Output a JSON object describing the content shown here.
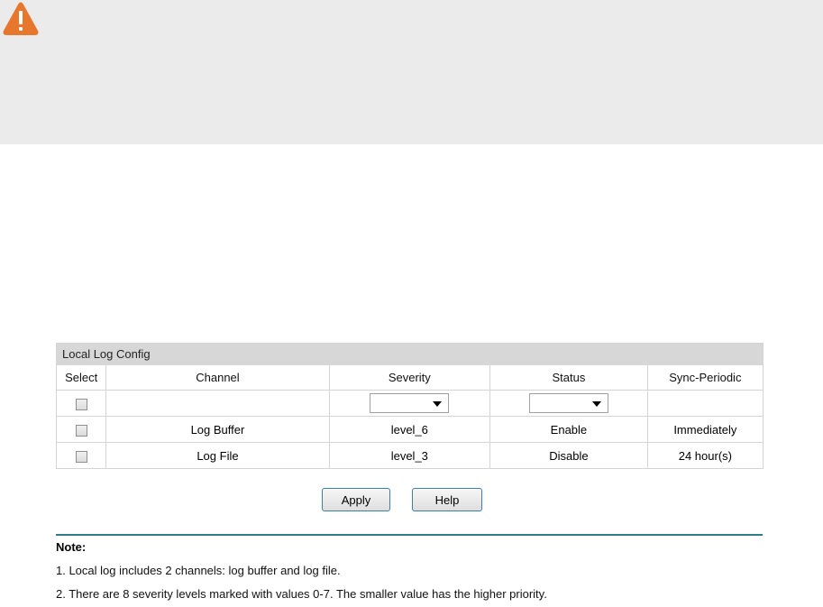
{
  "panel": {
    "title": "Local Log Config",
    "headers": [
      "Select",
      "Channel",
      "Severity",
      "Status",
      "Sync-Periodic"
    ],
    "rows": [
      {
        "channel": "Log Buffer",
        "severity": "level_6",
        "status": "Enable",
        "sync": "Immediately"
      },
      {
        "channel": "Log File",
        "severity": "level_3",
        "status": "Disable",
        "sync": "24 hour(s)"
      }
    ]
  },
  "buttons": {
    "apply": "Apply",
    "help": "Help"
  },
  "note": {
    "title": "Note:",
    "lines": [
      "1. Local log includes 2 channels: log buffer and log file.",
      "2. There are 8 severity levels marked with values 0-7. The smaller value has the higher priority."
    ]
  },
  "colors": {
    "warning": "#e8772e",
    "rule": "#2e7d8a",
    "button_border": "#3c7fb1",
    "banner": "#ebebeb"
  },
  "icons": {
    "banner": "warning-triangle-icon"
  }
}
